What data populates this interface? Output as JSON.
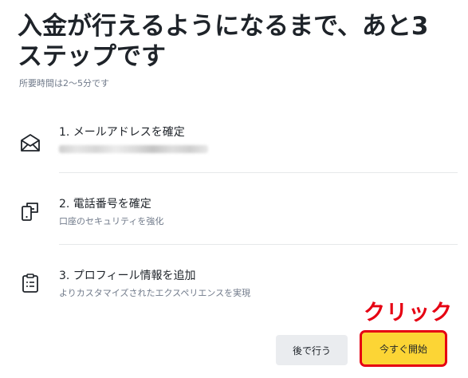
{
  "header": {
    "title": "入金が行えるようになるまで、あと3ステップです",
    "subtitle": "所要時間は2～5分です"
  },
  "steps": [
    {
      "label": "1. メールアドレスを確定",
      "description": "",
      "icon": "envelope-icon",
      "detail_redacted": true
    },
    {
      "label": "2. 電話番号を確定",
      "description": "口座のセキュリティを強化",
      "icon": "phone-link-icon"
    },
    {
      "label": "3. プロフィール情報を追加",
      "description": "よりカスタマイズされたエクスペリエンスを実現",
      "icon": "clipboard-icon"
    }
  ],
  "actions": {
    "later_label": "後で行う",
    "start_label": "今すぐ開始"
  },
  "annotation": {
    "text": "クリック",
    "color": "#e60012"
  },
  "colors": {
    "primary_button": "#fcd535",
    "secondary_button": "#eaecef",
    "highlight": "#e60012"
  }
}
